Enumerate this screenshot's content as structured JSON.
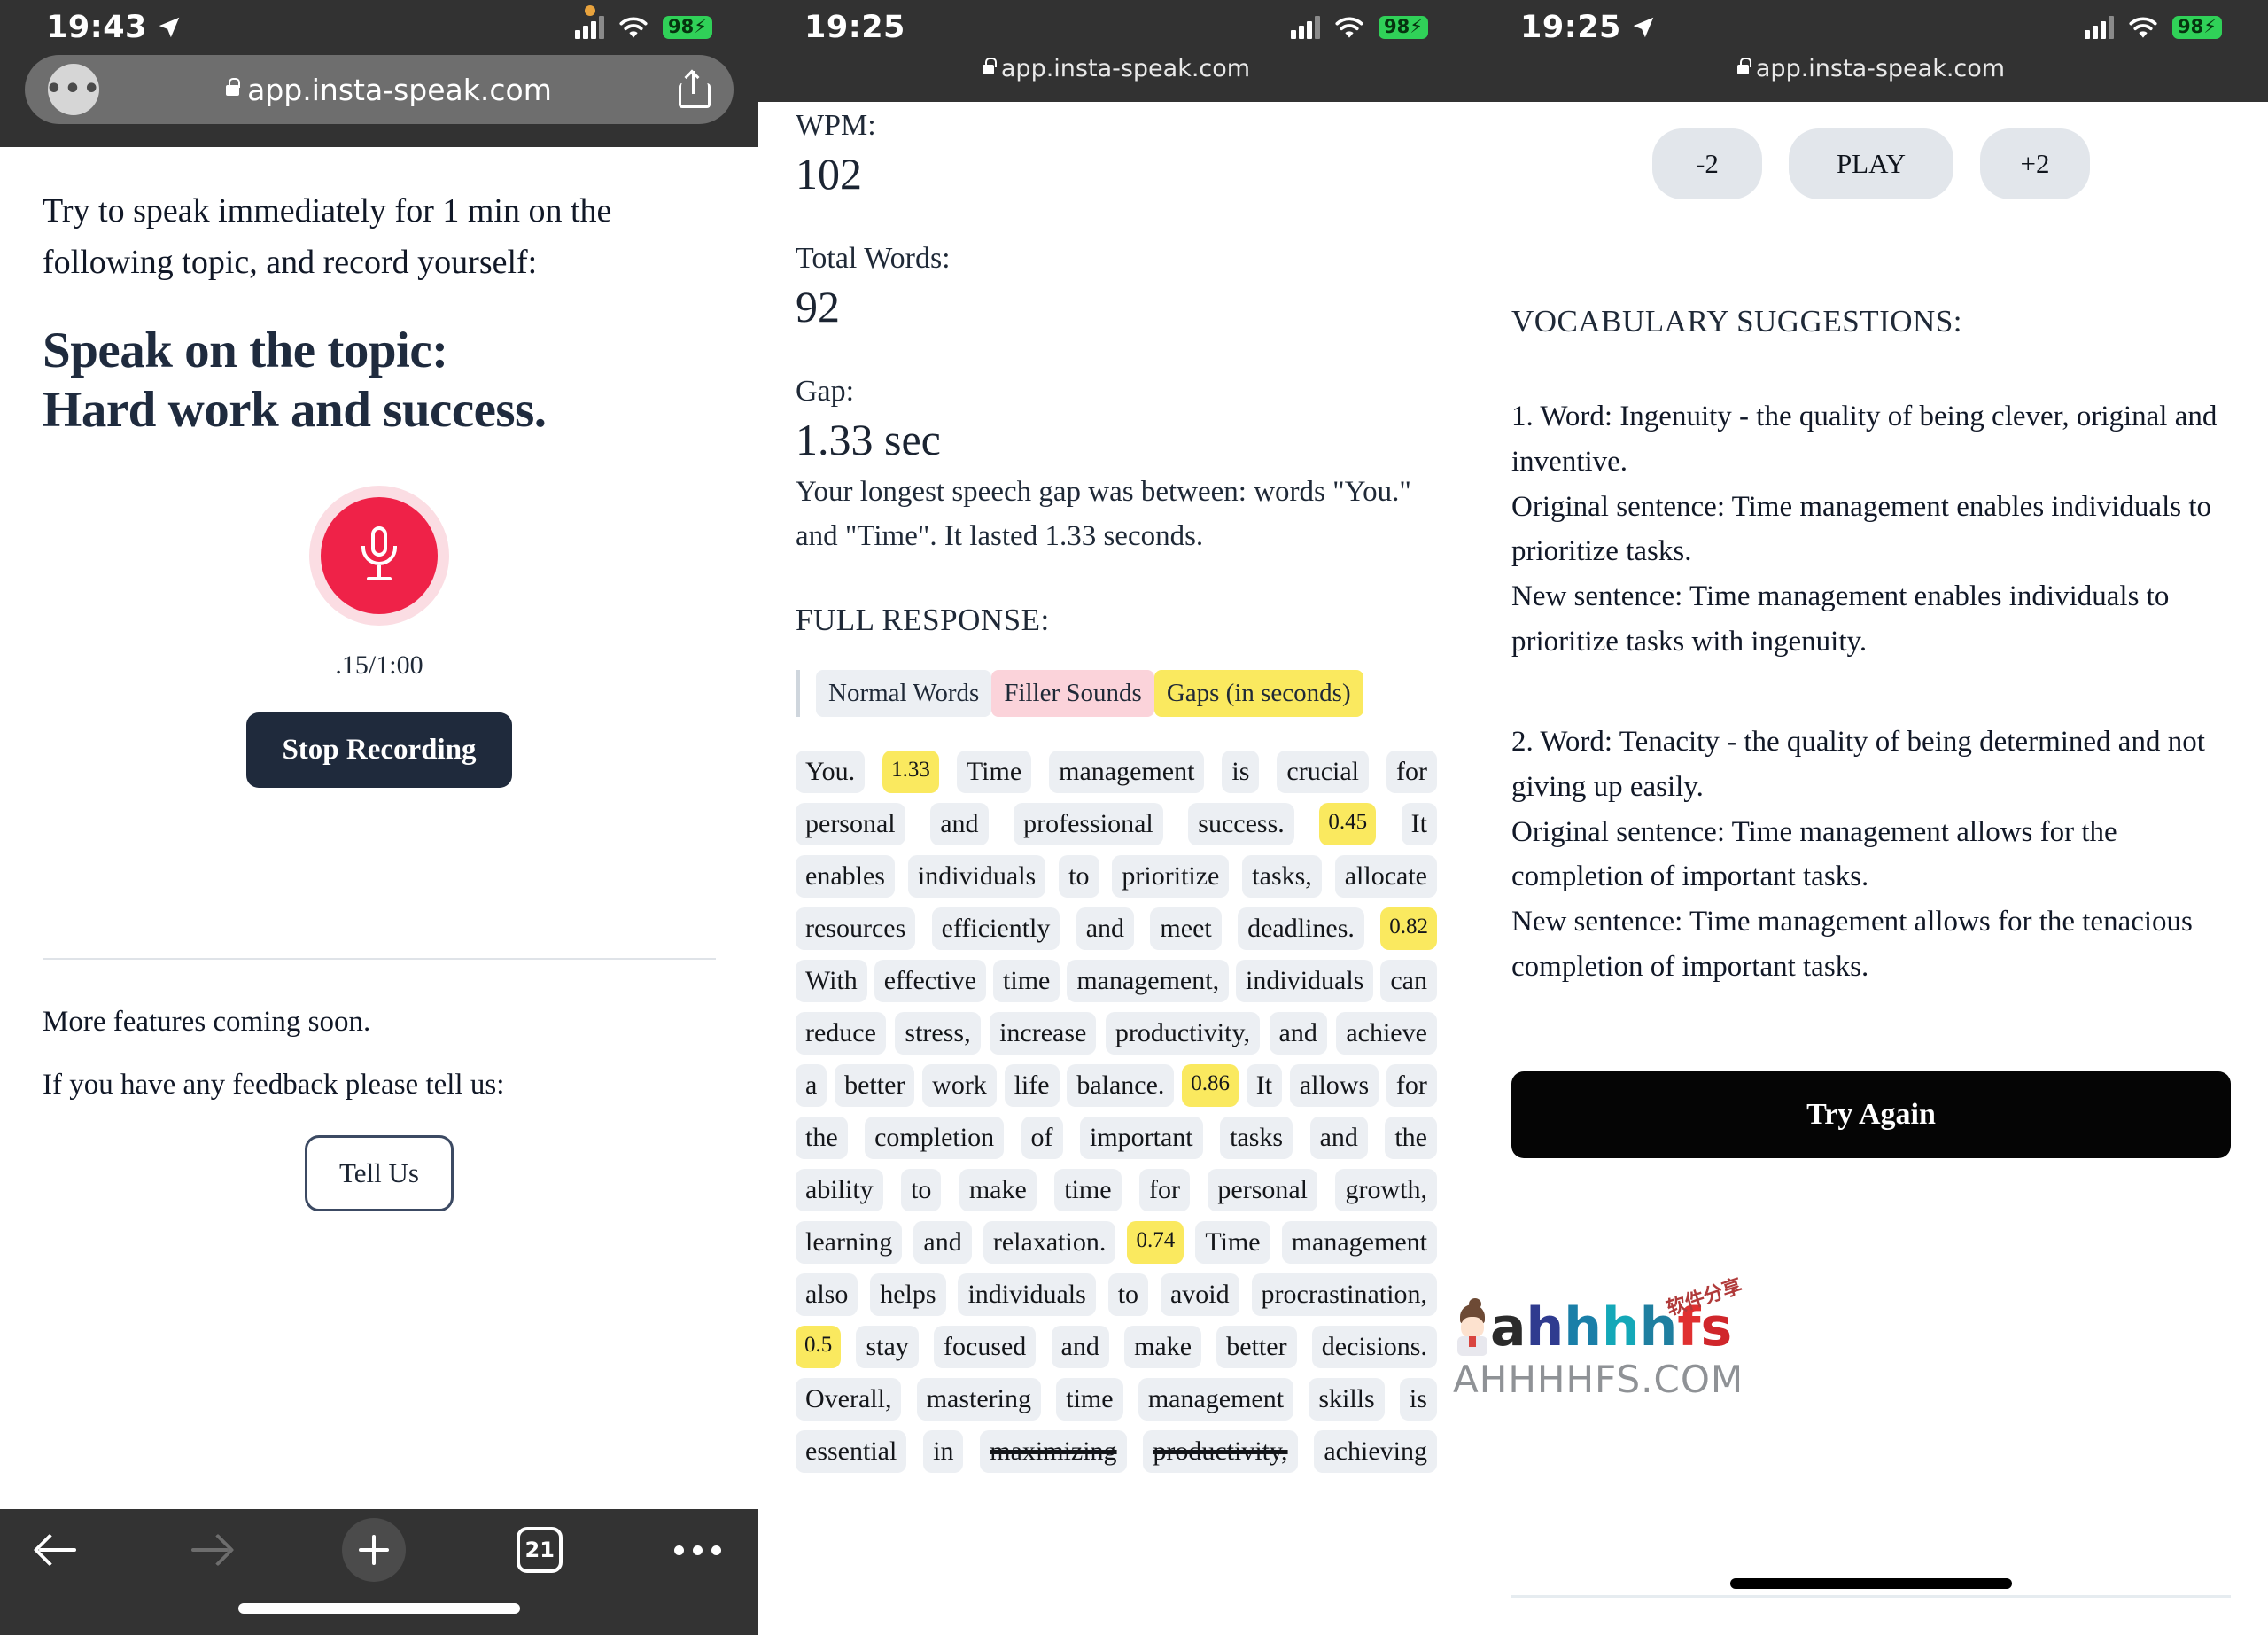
{
  "panel1": {
    "status": {
      "time": "19:43",
      "battery": "98",
      "location_icon": "location-arrow-icon"
    },
    "browser": {
      "url": "app.insta-speak.com",
      "aa_label": "•••"
    },
    "content": {
      "intro": "Try to speak immediately for 1 min on the following topic, and record yourself:",
      "topic_line1": "Speak on the topic:",
      "topic_line2": "Hard work and success.",
      "timer": ".15/1:00",
      "stop_label": "Stop Recording",
      "more_features": "More features coming soon.",
      "feedback_prompt": "If you have any feedback please tell us:",
      "tell_us_label": "Tell Us"
    },
    "toolbar": {
      "tab_count": "21"
    }
  },
  "panel2": {
    "status": {
      "time": "19:25",
      "battery": "98"
    },
    "browser": {
      "url": "app.insta-speak.com"
    },
    "stats": [
      {
        "label": "WPM:",
        "value": "102"
      },
      {
        "label": "Total Words:",
        "value": "92"
      },
      {
        "label": "Gap:",
        "value": "1.33 sec"
      }
    ],
    "gap_note": "Your longest speech gap was between: words \"You.\" and \"Time\". It lasted 1.33 seconds.",
    "full_response_title": "FULL RESPONSE:",
    "legend": [
      {
        "label": "Normal Words",
        "kind": "normal",
        "color": "#eceff3"
      },
      {
        "label": "Filler Sounds",
        "kind": "filler",
        "color": "#fbd3da"
      },
      {
        "label": "Gaps (in seconds)",
        "kind": "gaps",
        "color": "#fae95f"
      }
    ],
    "transcript_lines": [
      [
        {
          "t": "You.",
          "k": "w"
        },
        {
          "t": "1.33",
          "k": "g"
        },
        {
          "t": "Time",
          "k": "w"
        },
        {
          "t": "management",
          "k": "w"
        },
        {
          "t": "is",
          "k": "w"
        },
        {
          "t": "crucial",
          "k": "w"
        },
        {
          "t": "for",
          "k": "w"
        }
      ],
      [
        {
          "t": "personal",
          "k": "w"
        },
        {
          "t": "and",
          "k": "w"
        },
        {
          "t": "professional",
          "k": "w"
        },
        {
          "t": "success.",
          "k": "w"
        },
        {
          "t": "0.45",
          "k": "g"
        },
        {
          "t": "It",
          "k": "w"
        }
      ],
      [
        {
          "t": "enables",
          "k": "w"
        },
        {
          "t": "individuals",
          "k": "w"
        },
        {
          "t": "to",
          "k": "w"
        },
        {
          "t": "prioritize",
          "k": "w"
        },
        {
          "t": "tasks,",
          "k": "w"
        },
        {
          "t": "allocate",
          "k": "w"
        }
      ],
      [
        {
          "t": "resources",
          "k": "w"
        },
        {
          "t": "efficiently",
          "k": "w"
        },
        {
          "t": "and",
          "k": "w"
        },
        {
          "t": "meet",
          "k": "w"
        },
        {
          "t": "deadlines.",
          "k": "w"
        },
        {
          "t": "0.82",
          "k": "g"
        }
      ],
      [
        {
          "t": "With",
          "k": "w"
        },
        {
          "t": "effective",
          "k": "w"
        },
        {
          "t": "time",
          "k": "w"
        },
        {
          "t": "management,",
          "k": "w"
        },
        {
          "t": "individuals",
          "k": "w"
        },
        {
          "t": "can",
          "k": "w"
        }
      ],
      [
        {
          "t": "reduce",
          "k": "w"
        },
        {
          "t": "stress,",
          "k": "w"
        },
        {
          "t": "increase",
          "k": "w"
        },
        {
          "t": "productivity,",
          "k": "w"
        },
        {
          "t": "and",
          "k": "w"
        },
        {
          "t": "achieve",
          "k": "w"
        }
      ],
      [
        {
          "t": "a",
          "k": "w"
        },
        {
          "t": "better",
          "k": "w"
        },
        {
          "t": "work",
          "k": "w"
        },
        {
          "t": "life",
          "k": "w"
        },
        {
          "t": "balance.",
          "k": "w"
        },
        {
          "t": "0.86",
          "k": "g"
        },
        {
          "t": "It",
          "k": "w"
        },
        {
          "t": "allows",
          "k": "w"
        },
        {
          "t": "for",
          "k": "w"
        }
      ],
      [
        {
          "t": "the",
          "k": "w"
        },
        {
          "t": "completion",
          "k": "w"
        },
        {
          "t": "of",
          "k": "w"
        },
        {
          "t": "important",
          "k": "w"
        },
        {
          "t": "tasks",
          "k": "w"
        },
        {
          "t": "and",
          "k": "w"
        },
        {
          "t": "the",
          "k": "w"
        }
      ],
      [
        {
          "t": "ability",
          "k": "w"
        },
        {
          "t": "to",
          "k": "w"
        },
        {
          "t": "make",
          "k": "w"
        },
        {
          "t": "time",
          "k": "w"
        },
        {
          "t": "for",
          "k": "w"
        },
        {
          "t": "personal",
          "k": "w"
        },
        {
          "t": "growth,",
          "k": "w"
        }
      ],
      [
        {
          "t": "learning",
          "k": "w"
        },
        {
          "t": "and",
          "k": "w"
        },
        {
          "t": "relaxation.",
          "k": "w"
        },
        {
          "t": "0.74",
          "k": "g"
        },
        {
          "t": "Time",
          "k": "w"
        },
        {
          "t": "management",
          "k": "w"
        }
      ],
      [
        {
          "t": "also",
          "k": "w"
        },
        {
          "t": "helps",
          "k": "w"
        },
        {
          "t": "individuals",
          "k": "w"
        },
        {
          "t": "to",
          "k": "w"
        },
        {
          "t": "avoid",
          "k": "w"
        },
        {
          "t": "procrastination,",
          "k": "w"
        }
      ],
      [
        {
          "t": "0.5",
          "k": "g"
        },
        {
          "t": "stay",
          "k": "w"
        },
        {
          "t": "focused",
          "k": "w"
        },
        {
          "t": "and",
          "k": "w"
        },
        {
          "t": "make",
          "k": "w"
        },
        {
          "t": "better",
          "k": "w"
        },
        {
          "t": "decisions.",
          "k": "w"
        }
      ],
      [
        {
          "t": "Overall,",
          "k": "w"
        },
        {
          "t": "mastering",
          "k": "w"
        },
        {
          "t": "time",
          "k": "w"
        },
        {
          "t": "management",
          "k": "w"
        },
        {
          "t": "skills",
          "k": "w"
        },
        {
          "t": "is",
          "k": "w"
        }
      ],
      [
        {
          "t": "essential",
          "k": "w"
        },
        {
          "t": "in",
          "k": "w"
        },
        {
          "t": "maximizing",
          "k": "s"
        },
        {
          "t": "productivity,",
          "k": "s"
        },
        {
          "t": "achieving",
          "k": "w"
        }
      ]
    ]
  },
  "panel3": {
    "status": {
      "time": "19:25",
      "battery": "98"
    },
    "browser": {
      "url": "app.insta-speak.com"
    },
    "player": {
      "back_label": "-2",
      "play_label": "PLAY",
      "forward_label": "+2"
    },
    "vocab_title": "VOCABULARY SUGGESTIONS:",
    "vocab_items": [
      "1. Word: Ingenuity - the quality of being clever, original and inventive.\nOriginal sentence: Time management enables individuals to prioritize tasks.\nNew sentence: Time management enables individuals to prioritize tasks with ingenuity.",
      "2. Word: Tenacity - the quality of being determined and not giving up easily.\nOriginal sentence: Time management allows for the completion of important tasks.\nNew sentence: Time management allows for the tenacious completion of important tasks."
    ],
    "try_again_label": "Try Again"
  },
  "watermark": {
    "logo": "ahhhhfs",
    "cn": "软件分享",
    "url": "AHHHHFS.COM"
  }
}
